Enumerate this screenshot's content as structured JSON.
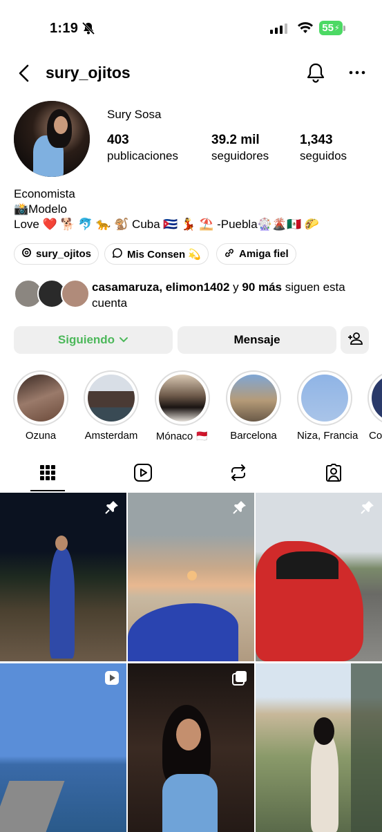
{
  "status_bar": {
    "time": "1:19",
    "battery": "55"
  },
  "header": {
    "username": "sury_ojitos"
  },
  "profile": {
    "full_name": "Sury Sosa",
    "stats": [
      {
        "value": "403",
        "label": "publicaciones"
      },
      {
        "value": "39.2 mil",
        "label": "seguidores"
      },
      {
        "value": "1,343",
        "label": "seguidos"
      }
    ],
    "bio": [
      "Economista",
      "📸Modelo",
      "Love ❤️ 🐕 🐬 🐆 🐒 Cuba 🇨🇺 💃 ⛱️ -Puebla🎡🌋🇲🇽 🌮"
    ],
    "chips": [
      "sury_ojitos",
      "Mis Consen 💫",
      "Amiga fiel"
    ]
  },
  "followed_by": {
    "names": "casamaruza, elimon1402",
    "joiner": " y ",
    "count": "90 más",
    "suffix": " siguen esta cuenta"
  },
  "actions": {
    "following": "Siguiendo",
    "message": "Mensaje"
  },
  "highlights": [
    {
      "label": "Ozuna"
    },
    {
      "label": "Amsterdam"
    },
    {
      "label": "Mónaco 🇲🇨"
    },
    {
      "label": "Barcelona"
    },
    {
      "label": "Niza, Francia"
    },
    {
      "label": "Co"
    }
  ],
  "colors": {
    "following_green": "#4cb85a",
    "battery_green": "#4cd964",
    "button_bg": "#efefef"
  }
}
